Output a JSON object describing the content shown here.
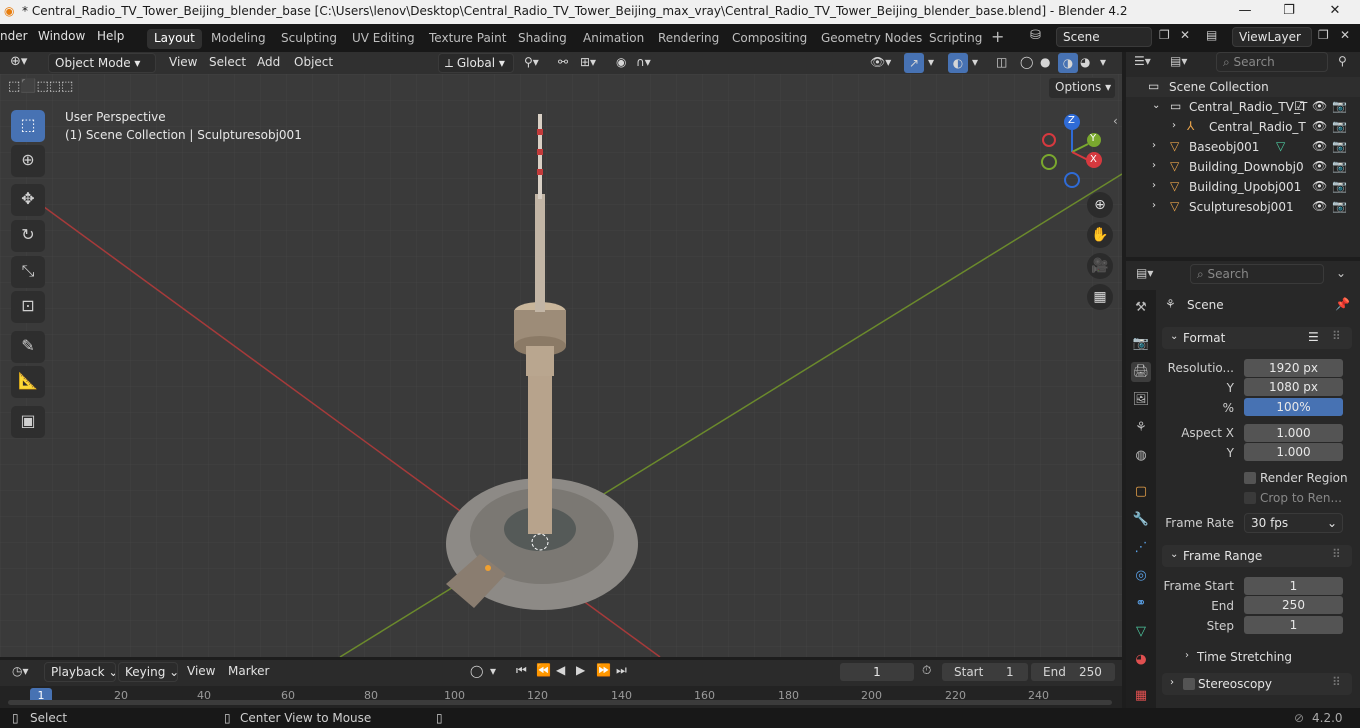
{
  "title_bar": {
    "title": "* Central_Radio_TV_Tower_Beijing_blender_base [C:\\Users\\lenov\\Desktop\\Central_Radio_TV_Tower_Beijing_max_vray\\Central_Radio_TV_Tower_Beijing_blender_base.blend] - Blender 4.2",
    "minimize": "—",
    "maximize": "❐",
    "close": "✕"
  },
  "menus": [
    "nder",
    "Window",
    "Help"
  ],
  "workspace_tabs": [
    "Layout",
    "Modeling",
    "Sculpting",
    "UV Editing",
    "Texture Paint",
    "Shading",
    "Animation",
    "Rendering",
    "Compositing",
    "Geometry Nodes",
    "Scripting"
  ],
  "active_tab": "Layout",
  "scene_field": "Scene",
  "viewlayer_field": "ViewLayer",
  "viewport_header": {
    "mode": "Object Mode",
    "menus": [
      "View",
      "Select",
      "Add",
      "Object"
    ],
    "transform": "Global",
    "options": "Options"
  },
  "viewport": {
    "perspective": "User Perspective",
    "collection_info": "(1) Scene Collection | Sculpturesobj001",
    "gizmo": {
      "x": "X",
      "y": "Y",
      "z": "Z"
    }
  },
  "outliner": {
    "search_placeholder": "Search",
    "rows": [
      {
        "label": "Scene Collection"
      },
      {
        "label": "Central_Radio_TV_T"
      },
      {
        "label": "Central_Radio_T"
      },
      {
        "label": "Baseobj001"
      },
      {
        "label": "Building_Downobj0"
      },
      {
        "label": "Building_Upobj001"
      },
      {
        "label": "Sculpturesobj001"
      }
    ]
  },
  "properties": {
    "search_placeholder": "Search",
    "context": "Scene",
    "format": {
      "header": "Format",
      "resolution_label": "Resolutio...",
      "res_x": "1920 px",
      "y_label": "Y",
      "res_y": "1080 px",
      "pct_label": "%",
      "pct": "100%",
      "aspect_x_label": "Aspect X",
      "aspect_x": "1.000",
      "aspect_y_label": "Y",
      "aspect_y": "1.000",
      "render_region": "Render Region",
      "crop": "Crop to Ren...",
      "frame_rate_label": "Frame Rate",
      "frame_rate": "30 fps"
    },
    "frame_range": {
      "header": "Frame Range",
      "start_label": "Frame Start",
      "start": "1",
      "end_label": "End",
      "end": "250",
      "step_label": "Step",
      "step": "1"
    },
    "time_stretching": "Time Stretching",
    "stereoscopy": "Stereoscopy"
  },
  "timeline": {
    "menus": [
      "Playback",
      "Keying",
      "View",
      "Marker"
    ],
    "current_frame": "1",
    "start_label": "Start",
    "start": "1",
    "end_label": "End",
    "end": "250",
    "ruler": [
      "1",
      "20",
      "40",
      "60",
      "80",
      "100",
      "120",
      "140",
      "160",
      "180",
      "200",
      "220",
      "240"
    ]
  },
  "status_bar": {
    "select": "Select",
    "center_view": "Center View to Mouse",
    "version": "4.2.0"
  }
}
